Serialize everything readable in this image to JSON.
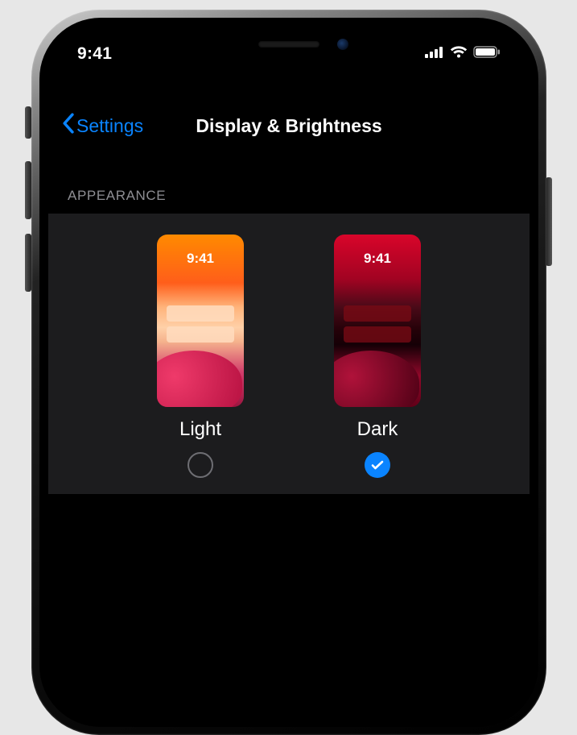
{
  "status": {
    "time": "9:41"
  },
  "nav": {
    "back_label": "Settings",
    "title": "Display & Brightness"
  },
  "appearance": {
    "section_label": "APPEARANCE",
    "preview_time": "9:41",
    "options": {
      "light": {
        "label": "Light",
        "selected": false
      },
      "dark": {
        "label": "Dark",
        "selected": true
      }
    }
  },
  "colors": {
    "accent": "#0a84ff",
    "panel": "#1c1c1e",
    "secondary_text": "#8e8e93"
  }
}
